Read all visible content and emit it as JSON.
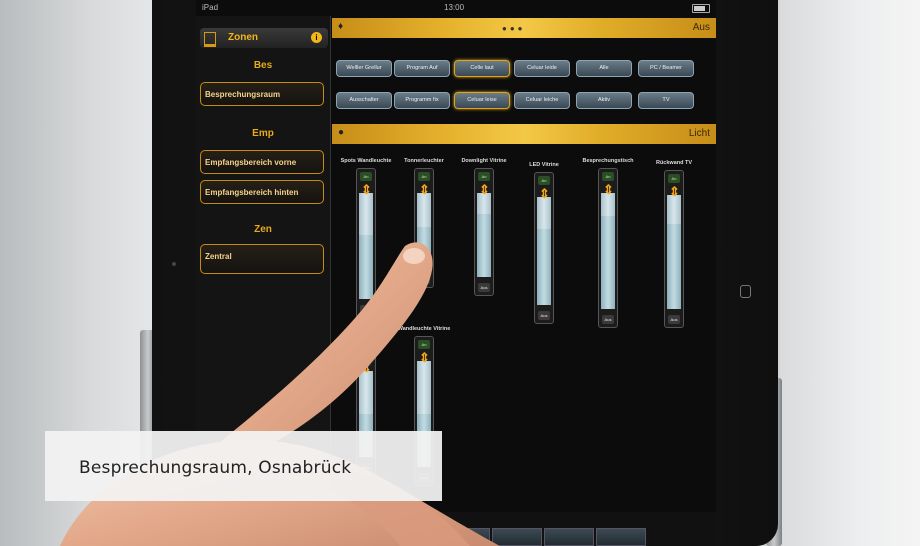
{
  "statusbar": {
    "device": "iPad",
    "time": "13:00",
    "right": ""
  },
  "sidebar": {
    "header": "Zonen",
    "groups": [
      {
        "title": "Bes",
        "items": [
          "Besprechungsraum"
        ]
      },
      {
        "title": "Emp",
        "items": [
          "Empfangsbereich vorne",
          "Empfangsbereich hinten"
        ]
      },
      {
        "title": "Zen",
        "items": [
          "Zentral"
        ]
      }
    ]
  },
  "scene_bar": {
    "label": "Aus"
  },
  "scene_buttons": [
    "Welller Grellur",
    "Program Auf",
    "Celle laut",
    "Celuar leide",
    "Alle",
    "PC / Beamer",
    "Ausschalter",
    "Programm fix",
    "Celuar leise",
    "Celuar leiche",
    "Aktiv",
    "TV"
  ],
  "light_bar": {
    "label": "Licht"
  },
  "sliders": [
    {
      "title": "Spots Wandleuchte",
      "on": "An",
      "off": "Aus",
      "level": 0.6
    },
    {
      "title": "Tonnerleuchter",
      "on": "An",
      "off": "Aus",
      "level": 0.55
    },
    {
      "title": "Downlight Vitrine",
      "on": "An",
      "off": "Aus",
      "level": 0.75
    },
    {
      "title": "LED Vitrine",
      "on": "An",
      "off": "Aus",
      "level": 0.7
    },
    {
      "title": "Besprechungstisch",
      "on": "An",
      "off": "Aus",
      "level": 0.8
    },
    {
      "title": "Rückwand TV",
      "on": "An",
      "off": "Aus",
      "level": 0.75
    },
    {
      "title": "",
      "on": "An",
      "off": "Aus",
      "level": 0.5
    },
    {
      "title": "Wandleuchte Vitrine",
      "on": "An",
      "off": "Aus",
      "level": 0.5
    }
  ],
  "tabbar": {
    "zones": "Zonen"
  },
  "caption": "Besprechungsraum, Osnabrück",
  "colors": {
    "accent": "#f0b61a",
    "screen": "#0c0c0c"
  }
}
